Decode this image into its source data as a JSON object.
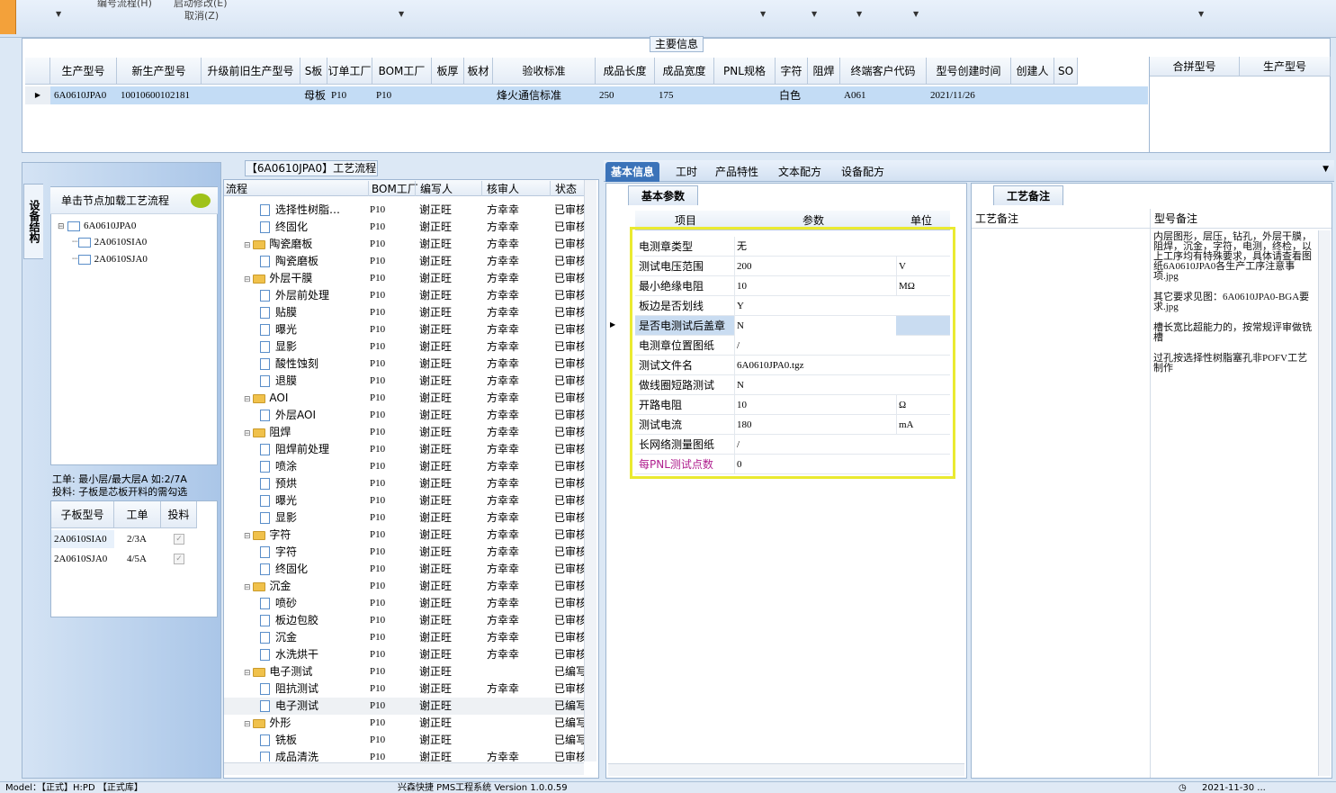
{
  "topbar": {
    "menu1": "编号流程(H)",
    "menu2": "启动修改(E)",
    "menu3": "取消(Z)"
  },
  "main_group_title": "主要信息",
  "main_table": {
    "headers": [
      "生产型号",
      "新生产型号",
      "升级前旧生产型号",
      "S板",
      "订单工厂",
      "BOM工厂",
      "板厚",
      "板材",
      "验收标准",
      "成品长度",
      "成品宽度",
      "PNL规格",
      "字符",
      "阻焊",
      "终端客户代码",
      "型号创建时间",
      "创建人",
      "SO"
    ],
    "row": [
      "6A0610JPA0",
      "10010600102181",
      "",
      "母板",
      "P10",
      "P10",
      "",
      "",
      "烽火通信标准",
      "250",
      "175",
      "",
      "白色",
      "",
      "A061",
      "2021/11/26",
      "",
      ""
    ]
  },
  "merge_table": {
    "headers": [
      "合拼型号",
      "生产型号"
    ]
  },
  "left": {
    "vtab": "设备结构",
    "load_button": "单击节点加载工艺流程",
    "tree_root": "6A0610JPA0",
    "tree_children": [
      "2A0610SIA0",
      "2A0610SJA0"
    ],
    "note_line1": "工单: 最小层/最大层A 如:2/7A",
    "note_line2": "投料: 子板是芯板开料的需勾选",
    "sub_headers": [
      "子板型号",
      "工单",
      "投料"
    ],
    "sub_rows": [
      [
        "2A0610SIA0",
        "2/3A"
      ],
      [
        "2A0610SJA0",
        "4/5A"
      ]
    ]
  },
  "flow": {
    "title": "【6A0610JPA0】工艺流程",
    "headers": [
      "流程",
      "BOM工厂",
      "编写人",
      "核审人",
      "状态"
    ],
    "rows": [
      {
        "name": "选择性树脂…",
        "lvl": 2,
        "bom": "P10",
        "writer": "谢正旺",
        "rev": "方幸幸",
        "status": "已审核"
      },
      {
        "name": "终固化",
        "lvl": 2,
        "bom": "P10",
        "writer": "谢正旺",
        "rev": "方幸幸",
        "status": "已审核"
      },
      {
        "name": "陶瓷磨板",
        "lvl": 1,
        "bom": "P10",
        "writer": "谢正旺",
        "rev": "方幸幸",
        "status": "已审核"
      },
      {
        "name": "陶瓷磨板",
        "lvl": 2,
        "bom": "P10",
        "writer": "谢正旺",
        "rev": "方幸幸",
        "status": "已审核"
      },
      {
        "name": "外层干膜",
        "lvl": 1,
        "bom": "P10",
        "writer": "谢正旺",
        "rev": "方幸幸",
        "status": "已审核"
      },
      {
        "name": "外层前处理",
        "lvl": 2,
        "bom": "P10",
        "writer": "谢正旺",
        "rev": "方幸幸",
        "status": "已审核"
      },
      {
        "name": "贴膜",
        "lvl": 2,
        "bom": "P10",
        "writer": "谢正旺",
        "rev": "方幸幸",
        "status": "已审核"
      },
      {
        "name": "曝光",
        "lvl": 2,
        "bom": "P10",
        "writer": "谢正旺",
        "rev": "方幸幸",
        "status": "已审核"
      },
      {
        "name": "显影",
        "lvl": 2,
        "bom": "P10",
        "writer": "谢正旺",
        "rev": "方幸幸",
        "status": "已审核"
      },
      {
        "name": "酸性蚀刻",
        "lvl": 2,
        "bom": "P10",
        "writer": "谢正旺",
        "rev": "方幸幸",
        "status": "已审核"
      },
      {
        "name": "退膜",
        "lvl": 2,
        "bom": "P10",
        "writer": "谢正旺",
        "rev": "方幸幸",
        "status": "已审核"
      },
      {
        "name": "AOI",
        "lvl": 1,
        "bom": "P10",
        "writer": "谢正旺",
        "rev": "方幸幸",
        "status": "已审核"
      },
      {
        "name": "外层AOI",
        "lvl": 2,
        "bom": "P10",
        "writer": "谢正旺",
        "rev": "方幸幸",
        "status": "已审核"
      },
      {
        "name": "阻焊",
        "lvl": 1,
        "bom": "P10",
        "writer": "谢正旺",
        "rev": "方幸幸",
        "status": "已审核"
      },
      {
        "name": "阻焊前处理",
        "lvl": 2,
        "bom": "P10",
        "writer": "谢正旺",
        "rev": "方幸幸",
        "status": "已审核"
      },
      {
        "name": "喷涂",
        "lvl": 2,
        "bom": "P10",
        "writer": "谢正旺",
        "rev": "方幸幸",
        "status": "已审核"
      },
      {
        "name": "预烘",
        "lvl": 2,
        "bom": "P10",
        "writer": "谢正旺",
        "rev": "方幸幸",
        "status": "已审核"
      },
      {
        "name": "曝光",
        "lvl": 2,
        "bom": "P10",
        "writer": "谢正旺",
        "rev": "方幸幸",
        "status": "已审核"
      },
      {
        "name": "显影",
        "lvl": 2,
        "bom": "P10",
        "writer": "谢正旺",
        "rev": "方幸幸",
        "status": "已审核"
      },
      {
        "name": "字符",
        "lvl": 1,
        "bom": "P10",
        "writer": "谢正旺",
        "rev": "方幸幸",
        "status": "已审核"
      },
      {
        "name": "字符",
        "lvl": 2,
        "bom": "P10",
        "writer": "谢正旺",
        "rev": "方幸幸",
        "status": "已审核"
      },
      {
        "name": "终固化",
        "lvl": 2,
        "bom": "P10",
        "writer": "谢正旺",
        "rev": "方幸幸",
        "status": "已审核"
      },
      {
        "name": "沉金",
        "lvl": 1,
        "bom": "P10",
        "writer": "谢正旺",
        "rev": "方幸幸",
        "status": "已审核"
      },
      {
        "name": "喷砂",
        "lvl": 2,
        "bom": "P10",
        "writer": "谢正旺",
        "rev": "方幸幸",
        "status": "已审核"
      },
      {
        "name": "板边包胶",
        "lvl": 2,
        "bom": "P10",
        "writer": "谢正旺",
        "rev": "方幸幸",
        "status": "已审核"
      },
      {
        "name": "沉金",
        "lvl": 2,
        "bom": "P10",
        "writer": "谢正旺",
        "rev": "方幸幸",
        "status": "已审核"
      },
      {
        "name": "水洗烘干",
        "lvl": 2,
        "bom": "P10",
        "writer": "谢正旺",
        "rev": "方幸幸",
        "status": "已审核"
      },
      {
        "name": "电子测试",
        "lvl": 1,
        "bom": "P10",
        "writer": "谢正旺",
        "rev": "",
        "status": "已编写"
      },
      {
        "name": "阻抗测试",
        "lvl": 2,
        "bom": "P10",
        "writer": "谢正旺",
        "rev": "方幸幸",
        "status": "已审核"
      },
      {
        "name": "电子测试",
        "lvl": 2,
        "bom": "P10",
        "writer": "谢正旺",
        "rev": "",
        "status": "已编写"
      },
      {
        "name": "外形",
        "lvl": 1,
        "bom": "P10",
        "writer": "谢正旺",
        "rev": "",
        "status": "已编写"
      },
      {
        "name": "铣板",
        "lvl": 2,
        "bom": "P10",
        "writer": "谢正旺",
        "rev": "",
        "status": "已编写"
      },
      {
        "name": "成品清洗",
        "lvl": 2,
        "bom": "P10",
        "writer": "谢正旺",
        "rev": "方幸幸",
        "status": "已审核"
      }
    ]
  },
  "tabs": [
    "基本信息",
    "工时",
    "产品特性",
    "文本配方",
    "设备配方"
  ],
  "basic": {
    "title": "基本参数",
    "headers": [
      "项目",
      "参数",
      "单位"
    ],
    "rows": [
      {
        "k": "电测章类型",
        "v": "无",
        "u": ""
      },
      {
        "k": "测试电压范围",
        "v": "200",
        "u": "V"
      },
      {
        "k": "最小绝缘电阻",
        "v": "10",
        "u": "MΩ"
      },
      {
        "k": "板边是否划线",
        "v": "Y",
        "u": ""
      },
      {
        "k": "是否电测试后盖章",
        "v": "N",
        "u": ""
      },
      {
        "k": "电测章位置图纸",
        "v": "/",
        "u": ""
      },
      {
        "k": "测试文件名",
        "v": "6A0610JPA0.tgz",
        "u": ""
      },
      {
        "k": "做线圈短路测试",
        "v": "N",
        "u": ""
      },
      {
        "k": "开路电阻",
        "v": "10",
        "u": "Ω"
      },
      {
        "k": "测试电流",
        "v": "180",
        "u": "mA"
      },
      {
        "k": "长网络测量图纸",
        "v": "/",
        "u": ""
      },
      {
        "k": "每PNL测试点数",
        "v": "0",
        "u": ""
      }
    ]
  },
  "notes": {
    "title": "工艺备注",
    "col1": "工艺备注",
    "col2": "型号备注",
    "text": [
      "内层图形，层压，钻孔，外层干膜，阻焊，沉金，字符，电测，终检，以上工序均有特殊要求，具体请查看图纸6A0610JPA0各生产工序注意事项.jpg",
      "其它要求见图：6A0610JPA0-BGA要求.jpg",
      "槽长宽比超能力的，按常规评审做铣槽",
      "过孔按选择性树脂塞孔非POFV工艺制作"
    ]
  },
  "status": {
    "left": "Model：【正式】H:PD 【正式库】",
    "center": "兴森快捷  PMS工程系统  Version 1.0.0.59",
    "right": "2021-11-30 ..."
  },
  "colors": {
    "selected_row": "#c3dcf5",
    "highlight_border": "#eaea30",
    "magenta": "#b0208f"
  }
}
